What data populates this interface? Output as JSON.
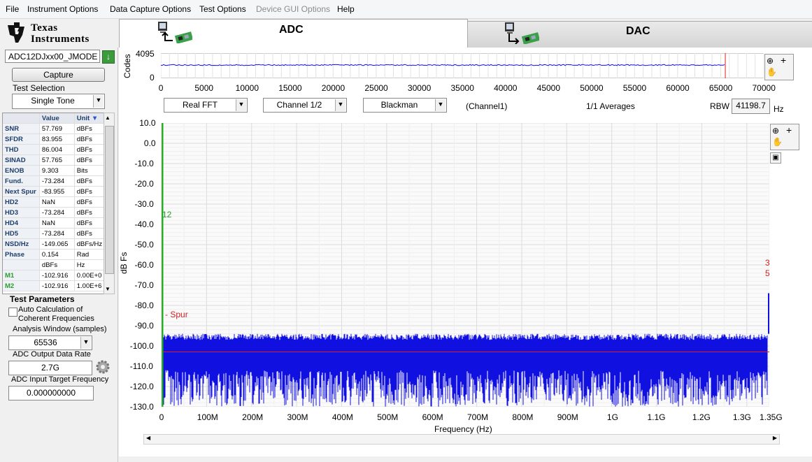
{
  "menu": [
    "File",
    "Instrument Options",
    "Data Capture Options",
    "Test Options",
    "Device GUI Options",
    "Help"
  ],
  "menu_disabled": [
    false,
    false,
    false,
    false,
    true,
    false
  ],
  "logo": {
    "line1": "Texas",
    "line2": "Instruments"
  },
  "tabs": {
    "adc": "ADC",
    "dac": "DAC"
  },
  "left": {
    "device": "ADC12DJxx00_JMODE",
    "capture_label": "Capture",
    "test_selection_label": "Test Selection",
    "test_selection_value": "Single Tone",
    "table_header": {
      "value": "Value",
      "unit": "Unit"
    },
    "rows": [
      {
        "name": "SNR",
        "value": "57.769",
        "unit": "dBFs"
      },
      {
        "name": "SFDR",
        "value": "83.955",
        "unit": "dBFs"
      },
      {
        "name": "THD",
        "value": "86.004",
        "unit": "dBFs"
      },
      {
        "name": "SINAD",
        "value": "57.765",
        "unit": "dBFs"
      },
      {
        "name": "ENOB",
        "value": "9.303",
        "unit": "Bits"
      },
      {
        "name": "Fund.",
        "value": "-73.284",
        "unit": "dBFs"
      },
      {
        "name": "Next Spur",
        "value": "-83.955",
        "unit": "dBFs"
      },
      {
        "name": "HD2",
        "value": "NaN",
        "unit": "dBFs"
      },
      {
        "name": "HD3",
        "value": "-73.284",
        "unit": "dBFs"
      },
      {
        "name": "HD4",
        "value": "NaN",
        "unit": "dBFs"
      },
      {
        "name": "HD5",
        "value": "-73.284",
        "unit": "dBFs"
      },
      {
        "name": "NSD/Hz",
        "value": "-149.065",
        "unit": "dBFs/Hz"
      },
      {
        "name": "Phase",
        "value": "0.154",
        "unit": "Rad"
      },
      {
        "name": "",
        "value": "dBFs",
        "unit": "Hz"
      },
      {
        "name": "M1",
        "value": "-102.916",
        "unit": "0.00E+0"
      },
      {
        "name": "M2",
        "value": "-102.916",
        "unit": "1.00E+6"
      }
    ],
    "test_params_title": "Test Parameters",
    "auto_calc_label_1": "Auto Calculation of",
    "auto_calc_label_2": "Coherent Frequencies",
    "analysis_window_label": "Analysis Window (samples)",
    "analysis_window_value": "65536",
    "output_rate_label": "ADC Output Data Rate",
    "output_rate_value": "2.7G",
    "input_freq_label": "ADC Input Target Frequency",
    "input_freq_value": "0.000000000"
  },
  "top_plot": {
    "ylabel": "Codes",
    "y_ticks": [
      "4095",
      "0"
    ],
    "x_ticks": [
      "0",
      "5000",
      "10000",
      "15000",
      "20000",
      "25000",
      "30000",
      "35000",
      "40000",
      "45000",
      "50000",
      "55000",
      "60000",
      "65000",
      "70000"
    ]
  },
  "controls": {
    "fft_type": "Real FFT",
    "channel": "Channel 1/2",
    "window": "Blackman",
    "channel_note": "(Channel1)",
    "averages": "1/1 Averages",
    "rbw_label": "RBW",
    "rbw_value": "41198.7",
    "rbw_unit": "Hz"
  },
  "main_plot": {
    "ylabel": "dB Fs",
    "xlabel": "Frequency (Hz)",
    "y_ticks": [
      "10.0",
      "0.0",
      "-10.0",
      "-20.0",
      "-30.0",
      "-40.0",
      "-50.0",
      "-60.0",
      "-70.0",
      "-80.0",
      "-90.0",
      "-100.0",
      "-110.0",
      "-120.0",
      "-130.0"
    ],
    "x_ticks": [
      "0",
      "100M",
      "200M",
      "300M",
      "400M",
      "500M",
      "600M",
      "700M",
      "800M",
      "900M",
      "1G",
      "1.1G",
      "1.2G",
      "1.3G",
      "1.35G"
    ],
    "spur_label": "Spur",
    "marker_left": "12",
    "marker_right_1": "3",
    "marker_right_2": "5"
  },
  "chart_data": {
    "type": "line",
    "xlabel": "Frequency (Hz)",
    "ylabel": "dB Fs",
    "xlim": [
      0,
      1350000000
    ],
    "ylim": [
      -130,
      10
    ],
    "series": [
      {
        "name": "Channel1",
        "noise_floor_range": [
          -130,
          -94
        ],
        "spur_at_end": -83.955
      }
    ],
    "noise_floor_line": -102.916,
    "colors": {
      "trace": "#1010e0",
      "floor": "#e02020",
      "marker": "#22b022"
    }
  }
}
